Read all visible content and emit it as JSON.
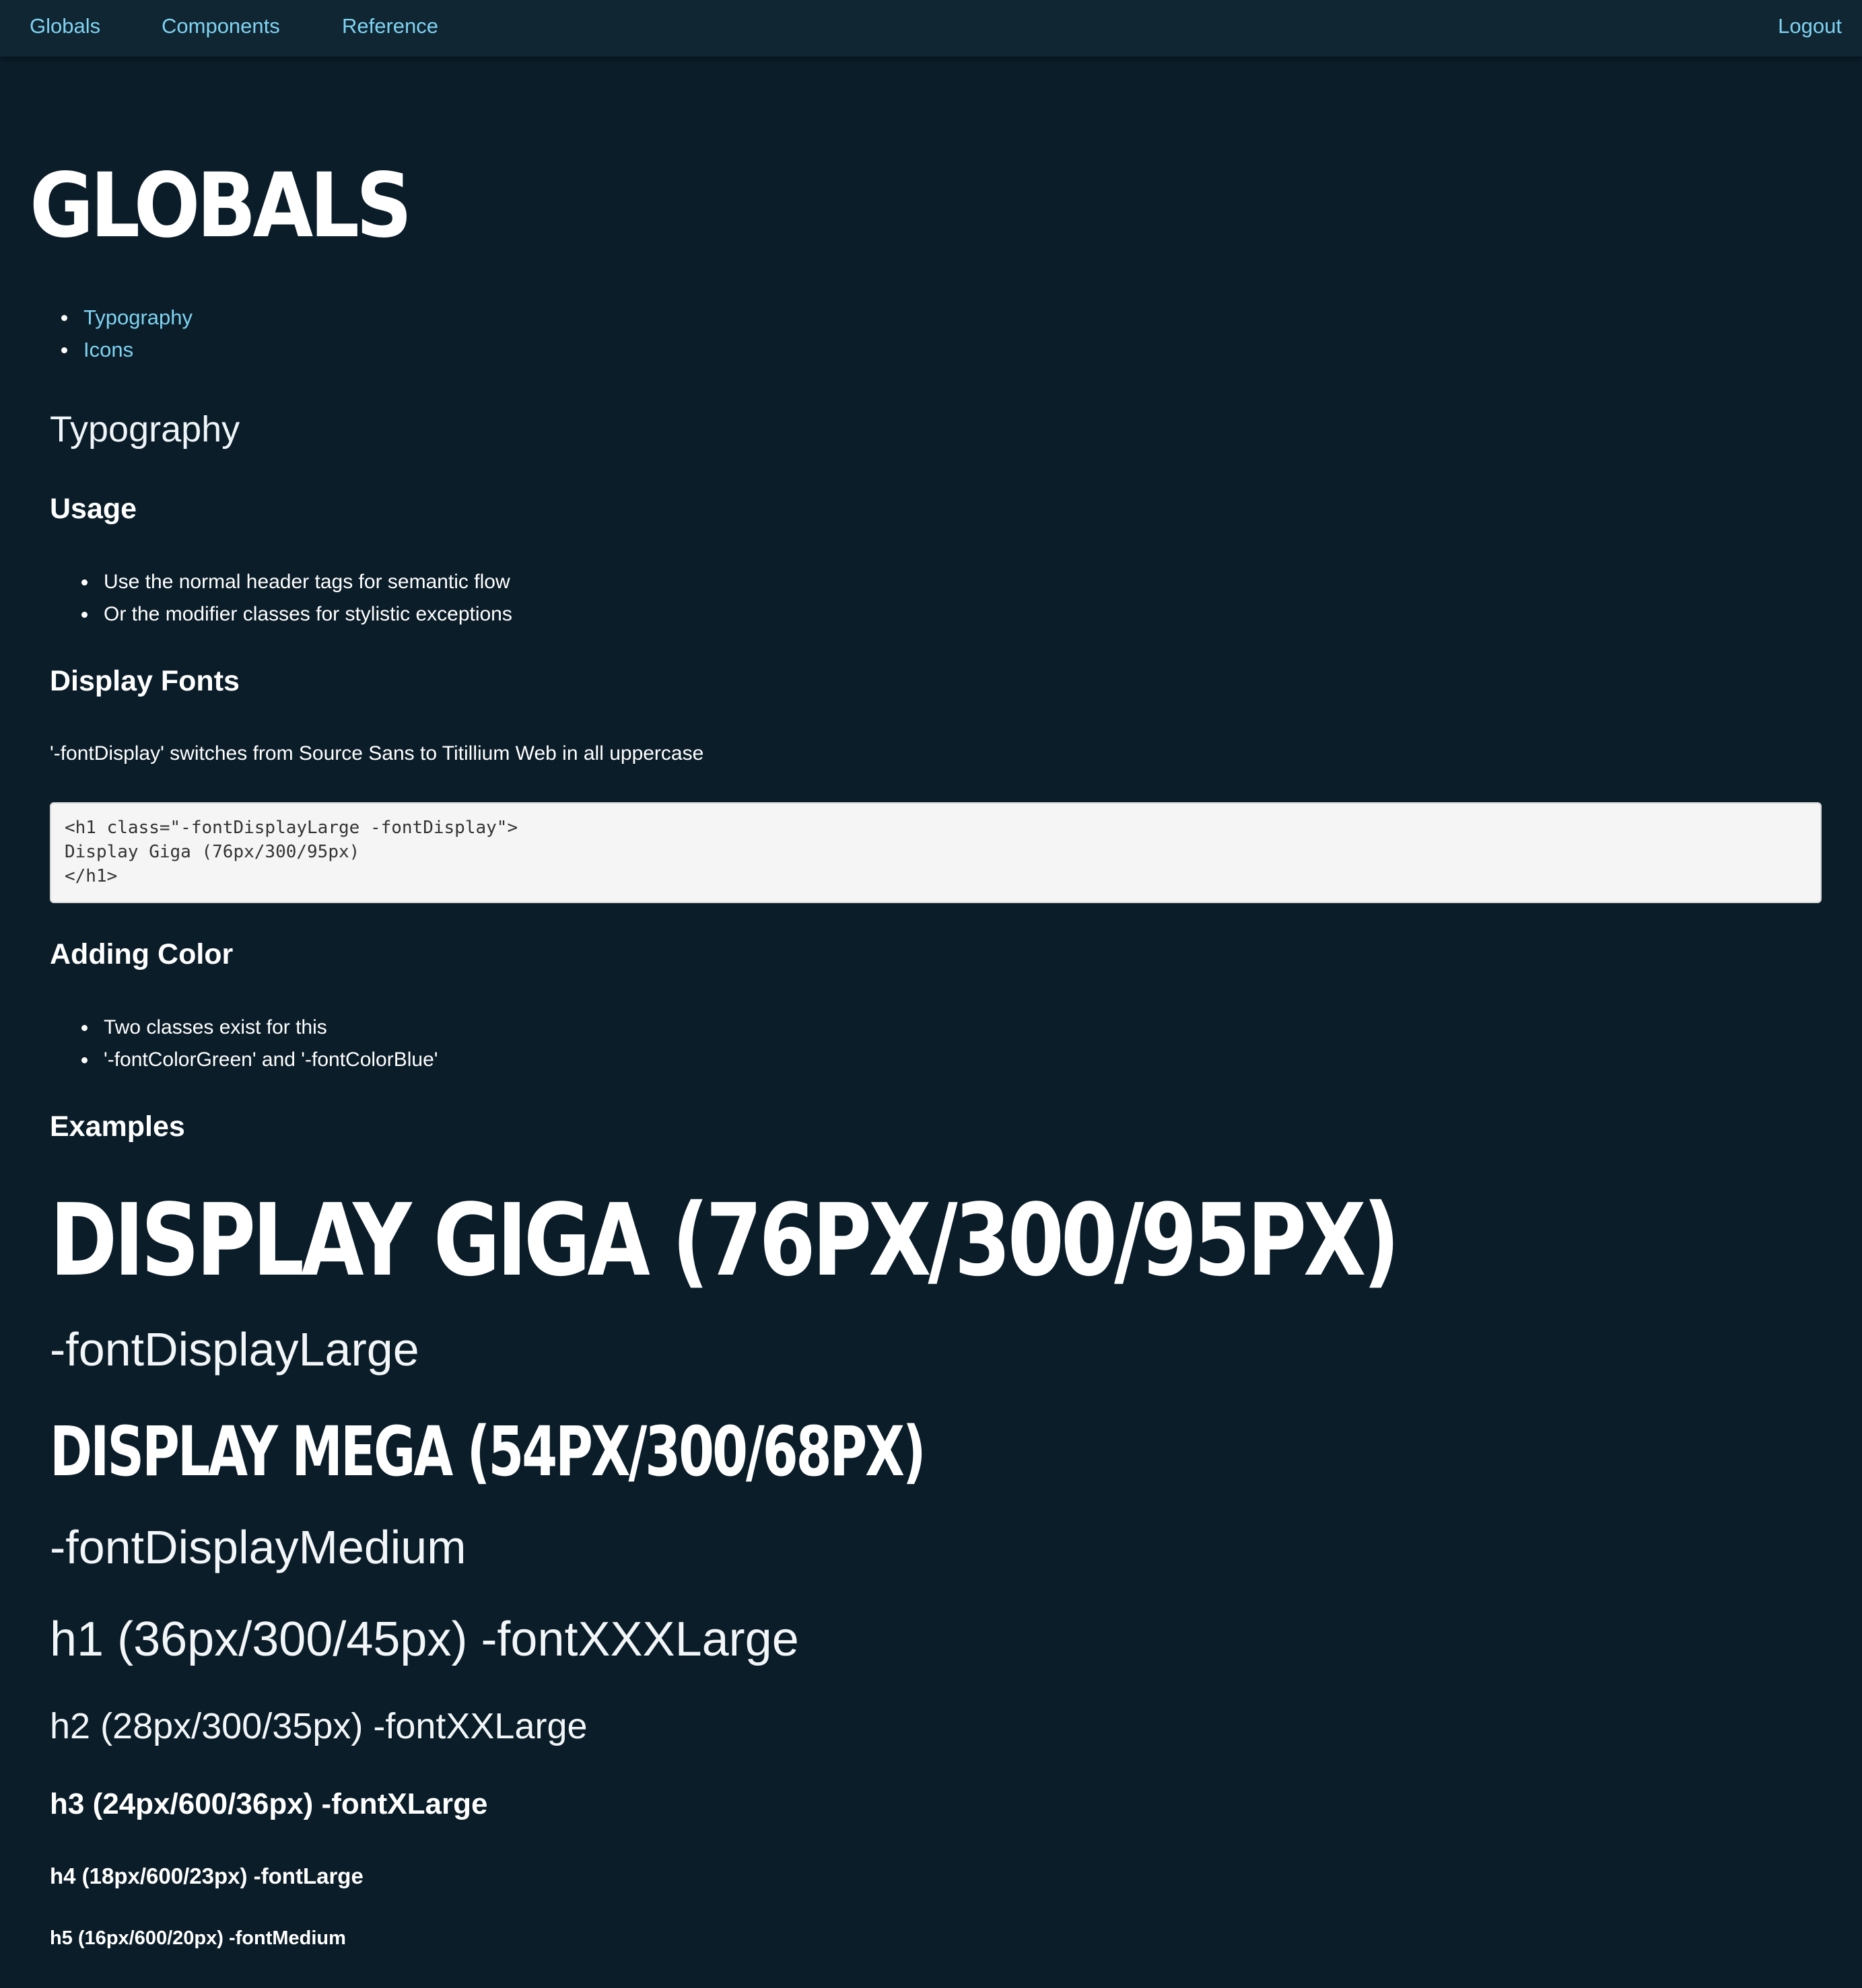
{
  "nav": {
    "globals": "Globals",
    "components": "Components",
    "reference": "Reference",
    "logout": "Logout"
  },
  "page": {
    "title": "GLOBALS",
    "toc": [
      "Typography",
      "Icons"
    ]
  },
  "typography": {
    "heading": "Typography",
    "usage": {
      "heading": "Usage",
      "items": [
        "Use the normal header tags for semantic flow",
        "Or the modifier classes for stylistic exceptions"
      ]
    },
    "display_fonts": {
      "heading": "Display Fonts",
      "description": "'-fontDisplay' switches from Source Sans to Titillium Web in all uppercase",
      "code": "<h1 class=\"-fontDisplayLarge -fontDisplay\">\nDisplay Giga (76px/300/95px)\n</h1>"
    },
    "adding_color": {
      "heading": "Adding Color",
      "items": [
        "Two classes exist for this",
        "'-fontColorGreen' and '-fontColorBlue'"
      ]
    },
    "examples": {
      "heading": "Examples",
      "display_giga": "DISPLAY GIGA (76PX/300/95PX)",
      "display_large_class": "-fontDisplayLarge",
      "display_mega": "DISPLAY MEGA (54PX/300/68PX)",
      "display_medium_class": "-fontDisplayMedium",
      "h1": "h1 (36px/300/45px) -fontXXXLarge",
      "h2": "h2 (28px/300/35px) -fontXXLarge",
      "h3": "h3 (24px/600/36px) -fontXLarge",
      "h4": "h4 (18px/600/23px) -fontLarge",
      "h5": "h5 (16px/600/20px) -fontMedium"
    }
  },
  "colors": {
    "background": "#0b1d29",
    "nav_background": "#112633",
    "link": "#7fd3f1",
    "text": "#ffffff",
    "code_background": "#f5f5f5"
  }
}
